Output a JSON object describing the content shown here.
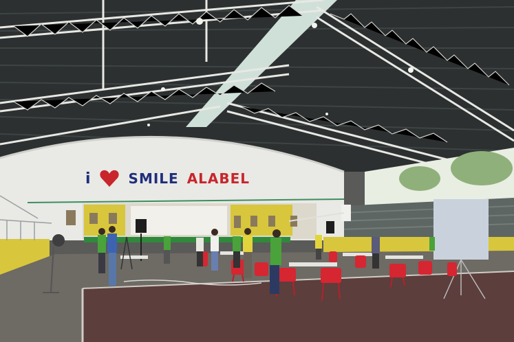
{
  "banner": {
    "i": "i",
    "smile": "SMILE",
    "alabel": "ALABEL"
  },
  "colors": {
    "banner_blue": "#1f2f7a",
    "banner_red": "#c8262c",
    "chair_red": "#d62631",
    "wall_yellow": "#d8c63c",
    "shirt_green": "#4aa23a"
  },
  "icons": [
    "heart-icon"
  ]
}
